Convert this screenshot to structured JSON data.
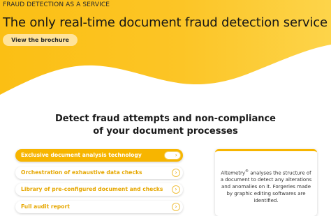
{
  "hero": {
    "eyebrow": "FRAUD DETECTION AS A SERVICE",
    "title": "The only real-time document fraud detection service",
    "brochure_button": "View the brochure"
  },
  "section": {
    "headline_line1": "Detect fraud attempts and non-compliance",
    "headline_line2": "of your document processes"
  },
  "features": {
    "items": [
      {
        "label": "Exclusive document analysis technology",
        "active": true
      },
      {
        "label": "Orchestration of exhaustive data checks",
        "active": false
      },
      {
        "label": "Library of pre-configured document and checks",
        "active": false
      },
      {
        "label": "Full audit report",
        "active": false
      }
    ]
  },
  "info_card": {
    "brand": "Altemetry",
    "registered_mark": "®",
    "text": " analyses the structure of a document to detect any alterations and anomalies on it. Forgeries made by graphic editing softwares are identified."
  },
  "colors": {
    "accent": "#f7b500",
    "accent_light": "#ffe39a",
    "hero_bg": "#fcc21f"
  }
}
